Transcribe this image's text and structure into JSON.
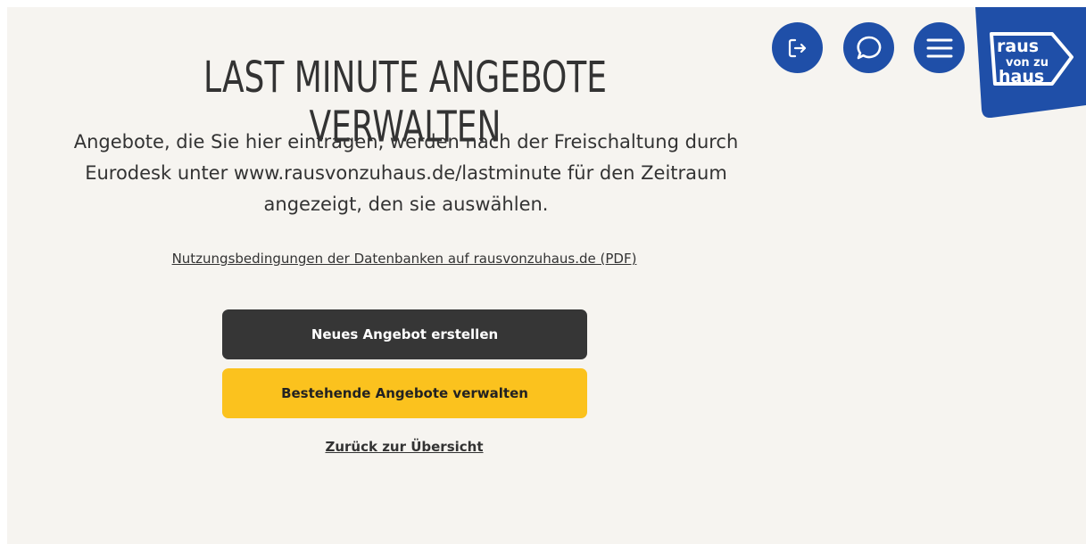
{
  "page": {
    "title": "LAST MINUTE ANGEBOTE VERWALTEN",
    "description": "Angebote, die Sie hier eintragen, werden nach der Freischaltung durch Eurodesk unter www.rausvonzuhaus.de/lastminute für den Zeitraum angezeigt, den sie auswählen.",
    "terms_link": "Nutzungsbedingungen der Datenbanken auf rausvonzuhaus.de (PDF)"
  },
  "actions": {
    "new_offer": "Neues Angebot erstellen",
    "manage_offers": "Bestehende Angebote verwalten",
    "back_link": "Zurück zur Übersicht"
  },
  "header": {
    "icons": [
      "logout-icon",
      "chat-icon",
      "menu-icon"
    ],
    "logo": {
      "line1": "raus",
      "line2": "von zu",
      "line3": "haus"
    }
  },
  "colors": {
    "brand_blue": "#1f4fa8",
    "accent_yellow": "#fbc21e",
    "dark_button": "#363636",
    "background": "#f6f4f0"
  }
}
